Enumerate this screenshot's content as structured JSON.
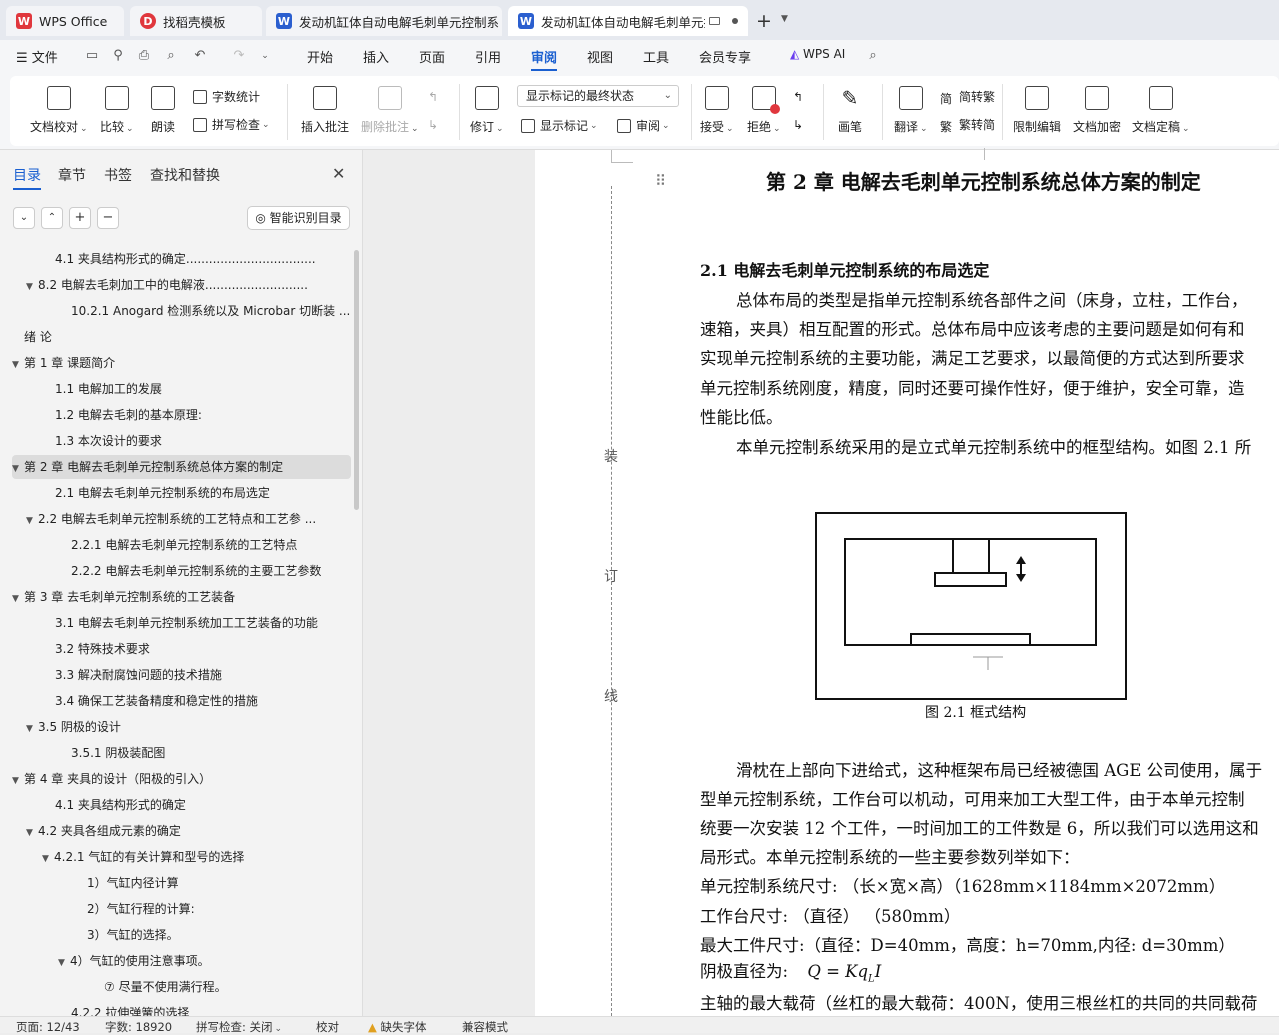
{
  "tabs": [
    {
      "label": "WPS Office",
      "icon": "wps-logo-icon"
    },
    {
      "label": "找稻壳模板",
      "icon": "docer-logo-icon"
    },
    {
      "label": "发动机缸体自动电解毛刺单元控制系",
      "icon": "word-doc-icon"
    },
    {
      "label": "发动机缸体自动电解毛刺单元控",
      "icon": "word-doc-icon"
    }
  ],
  "new_tab_label": "+",
  "menu": {
    "file": "文件",
    "items": [
      "开始",
      "插入",
      "页面",
      "引用",
      "审阅",
      "视图",
      "工具",
      "会员专享"
    ],
    "active": "审阅",
    "wps_ai": "WPS AI"
  },
  "ribbon": {
    "doc_check": "文档校对",
    "compare": "比较",
    "read_aloud": "朗读",
    "word_count": "字数统计",
    "spell_check": "拼写检查",
    "insert_comment": "插入批注",
    "delete_comment": "删除批注",
    "track": "修订",
    "markup_state": "显示标记的最终状态",
    "show_markup": "显示标记",
    "review": "审阅",
    "accept": "接受",
    "reject": "拒绝",
    "pen": "画笔",
    "translate": "翻译",
    "to_traditional": "简转繁",
    "to_simplified": "繁转简",
    "restrict_edit": "限制编辑",
    "encrypt": "文档加密",
    "finalize": "文档定稿"
  },
  "panel": {
    "tabs": [
      "目录",
      "章节",
      "书签",
      "查找和替换"
    ],
    "active_tab": "目录",
    "smart_toc": "智能识别目录",
    "toc": [
      {
        "text": "4.1  夹具结构形式的确定..................................",
        "level": 2,
        "caret": ""
      },
      {
        "text": "8.2  电解去毛刺加工中的电解液...........................",
        "level": 1,
        "caret": "▼"
      },
      {
        "text": "10.2.1 Anogard 检测系统以及 Microbar 切断装 ...",
        "level": 3,
        "caret": ""
      },
      {
        "text": "绪  论",
        "level": 0,
        "caret": ""
      },
      {
        "text": "第 1 章  课题简介",
        "level": 0,
        "caret": "▼"
      },
      {
        "text": "1.1  电解加工的发展",
        "level": 2,
        "caret": ""
      },
      {
        "text": "1.2  电解去毛刺的基本原理:",
        "level": 2,
        "caret": ""
      },
      {
        "text": "1.3  本次设计的要求",
        "level": 2,
        "caret": ""
      },
      {
        "text": "第 2 章  电解去毛刺单元控制系统总体方案的制定",
        "level": 0,
        "caret": "▼",
        "selected": true
      },
      {
        "text": "2.1  电解去毛刺单元控制系统的布局选定",
        "level": 2,
        "caret": ""
      },
      {
        "text": "2.2    电解去毛刺单元控制系统的工艺特点和工艺参 ...",
        "level": 1,
        "caret": "▼"
      },
      {
        "text": "2.2.1  电解去毛刺单元控制系统的工艺特点",
        "level": 3,
        "caret": ""
      },
      {
        "text": "2.2.2  电解去毛刺单元控制系统的主要工艺参数",
        "level": 3,
        "caret": ""
      },
      {
        "text": "第 3 章  去毛刺单元控制系统的工艺装备",
        "level": 0,
        "caret": "▼"
      },
      {
        "text": "3.1  电解去毛刺单元控制系统加工工艺装备的功能",
        "level": 2,
        "caret": ""
      },
      {
        "text": "3.2  特殊技术要求",
        "level": 2,
        "caret": ""
      },
      {
        "text": "3.3  解决耐腐蚀问题的技术措施",
        "level": 2,
        "caret": ""
      },
      {
        "text": "3.4  确保工艺装备精度和稳定性的措施",
        "level": 2,
        "caret": ""
      },
      {
        "text": "3.5 阴极的设计",
        "level": 1,
        "caret": "▼"
      },
      {
        "text": "3.5.1  阴极装配图",
        "level": 3,
        "caret": ""
      },
      {
        "text": "第 4 章  夹具的设计（阳极的引入）",
        "level": 0,
        "caret": "▼"
      },
      {
        "text": "4.1  夹具结构形式的确定",
        "level": 2,
        "caret": ""
      },
      {
        "text": "4.2    夹具各组成元素的确定",
        "level": 1,
        "caret": "▼"
      },
      {
        "text": "4.2.1  气缸的有关计算和型号的选择",
        "level": 2.5,
        "caret": "▼"
      },
      {
        "text": "1）气缸内径计算",
        "level": 4,
        "caret": ""
      },
      {
        "text": "2）气缸行程的计算:",
        "level": 4,
        "caret": ""
      },
      {
        "text": "3）气缸的选择。",
        "level": 4,
        "caret": ""
      },
      {
        "text": "4）气缸的使用注意事项。",
        "level": 3.5,
        "caret": "▼"
      },
      {
        "text": "⑦  尽量不使用满行程。",
        "level": 5,
        "caret": ""
      },
      {
        "text": "4.2.2  拉伸弹簧的选择",
        "level": 3,
        "caret": ""
      }
    ]
  },
  "document": {
    "chapter_title": "第 2 章  电解去毛刺单元控制系统总体方案的制定",
    "section_title": "2.1  电解去毛刺单元控制系统的布局选定",
    "para1": [
      "总体布局的类型是指单元控制系统各部件之间（床身，立柱，工作台，",
      "速箱，夹具）相互配置的形式。总体布局中应该考虑的主要问题是如何有和",
      "实现单元控制系统的主要功能，满足工艺要求，以最简便的方式达到所要求",
      "单元控制系统刚度，精度，同时还要可操作性好，便于维护，安全可靠，造",
      "性能比低。"
    ],
    "para2": "本单元控制系统采用的是立式单元控制系统中的框型结构。如图 2.1 所",
    "figure_caption": "图 2.1  框式结构",
    "para3": [
      "滑枕在上部向下进给式，这种框架布局已经被德国 AGE 公司使用，属于",
      "型单元控制系统，工作台可以机动，可用来加工大型工件，由于本单元控制",
      "统要一次安装 12 个工件，一时间加工的工件数是 6，所以我们可以选用这和",
      "局形式。本单元控制系统的一些主要参数列举如下："
    ],
    "params": [
      "单元控制系统尺寸:      （长×宽×高）（1628mm×1184mm×2072mm）",
      "工作台尺寸:   （直径）      （580mm）",
      "最大工件尺寸:（直径：D=40mm，高度：h=70mm,内径: d=30mm）"
    ],
    "cathode_label": "阴极直径为:",
    "formula_text": "Q = Kq",
    "formula_sub": "L",
    "formula_tail": "I",
    "last_line": "主轴的最大载荷（丝杠的最大载荷：400N，使用三根丝杠的共同的共同载荷",
    "binding_marks": [
      "装",
      "订",
      "线"
    ]
  },
  "status": {
    "page": "页面: 12/43",
    "words": "字数: 18920",
    "spell": "拼写检查: 关闭",
    "proof": "校对",
    "missing_font": "缺失字体",
    "compat": "兼容模式"
  },
  "colors": {
    "accent": "#1a5fd0",
    "wps_red": "#e0373d",
    "word_blue": "#2b5fcf"
  }
}
